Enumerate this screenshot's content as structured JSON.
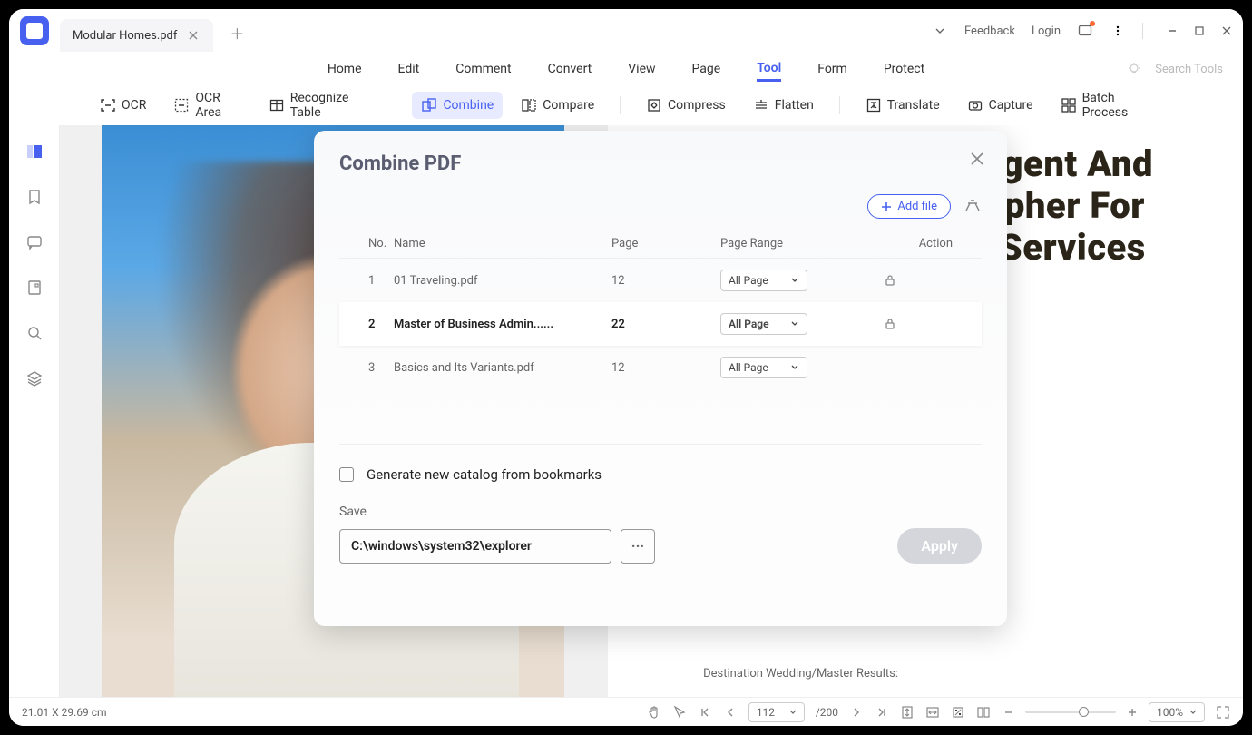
{
  "titlebar": {
    "tab_title": "Modular Homes.pdf",
    "feedback": "Feedback",
    "login": "Login"
  },
  "menu": {
    "items": [
      "Home",
      "Edit",
      "Comment",
      "Convert",
      "View",
      "Page",
      "Tool",
      "Form",
      "Protect"
    ],
    "active": "Tool",
    "search_placeholder": "Search Tools"
  },
  "toolbar": {
    "ocr": "OCR",
    "ocr_area": "OCR Area",
    "recognize_table": "Recognize Table",
    "combine": "Combine",
    "compare": "Compare",
    "compress": "Compress",
    "flatten": "Flatten",
    "translate": "Translate",
    "capture": "Capture",
    "batch_process": "Batch Process"
  },
  "doc": {
    "title_line1": "lligent And",
    "title_line2": "rapher For",
    "title_line3": "y Services",
    "caption": "Destination Wedding/Master Results:"
  },
  "dialog": {
    "title": "Combine PDF",
    "add_file": "Add file",
    "columns": {
      "no": "No.",
      "name": "Name",
      "page": "Page",
      "range": "Page Range",
      "action": "Action"
    },
    "rows": [
      {
        "no": "1",
        "name": "01 Traveling.pdf",
        "page": "12",
        "range": "All Page",
        "locked": true,
        "selected": false
      },
      {
        "no": "2",
        "name": "Master of Business Admin......",
        "page": "22",
        "range": "All Page",
        "locked": true,
        "selected": true
      },
      {
        "no": "3",
        "name": "Basics and Its Variants.pdf",
        "page": "12",
        "range": "All Page",
        "locked": false,
        "selected": false
      }
    ],
    "checkbox_label": "Generate new catalog from bookmarks",
    "save_label": "Save",
    "save_path": "C:\\windows\\system32\\explorer",
    "apply": "Apply"
  },
  "statusbar": {
    "dimensions": "21.01 X 29.69 cm",
    "page": "112",
    "total": "/200",
    "zoom": "100%"
  }
}
